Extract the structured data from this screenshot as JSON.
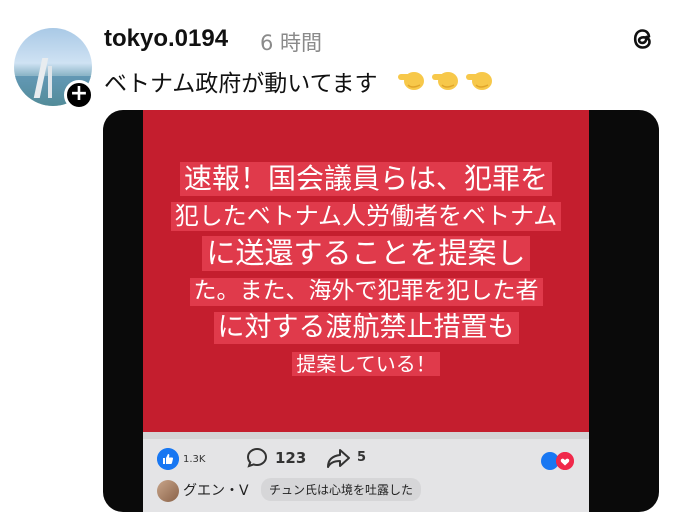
{
  "post": {
    "username": "tokyo.0194",
    "time": "6 時間",
    "caption": "ベトナム政府が動いてます",
    "emojis": [
      "pointing-hand-emoji",
      "pointing-hand-emoji",
      "pointing-hand-emoji"
    ]
  },
  "image": {
    "headline_lines": [
      "速報！国会議員らは、犯罪を",
      "犯したベトナム人労働者をベトナム",
      "に送還することを提案し",
      "た。また、海外で犯罪を犯した者",
      "に対する渡航禁止措置も",
      "提案している！"
    ],
    "reactions_count": "1.3K",
    "comments_count": "123",
    "shares_count": "5",
    "commenter_name": "グエン・V",
    "comment_text": "チュン氏は心境を吐露した"
  },
  "colors": {
    "banner_red": "#c41e2e",
    "text_highlight": "#e03a4b",
    "facebook_blue": "#1877f2",
    "heart_red": "#f0284a"
  }
}
